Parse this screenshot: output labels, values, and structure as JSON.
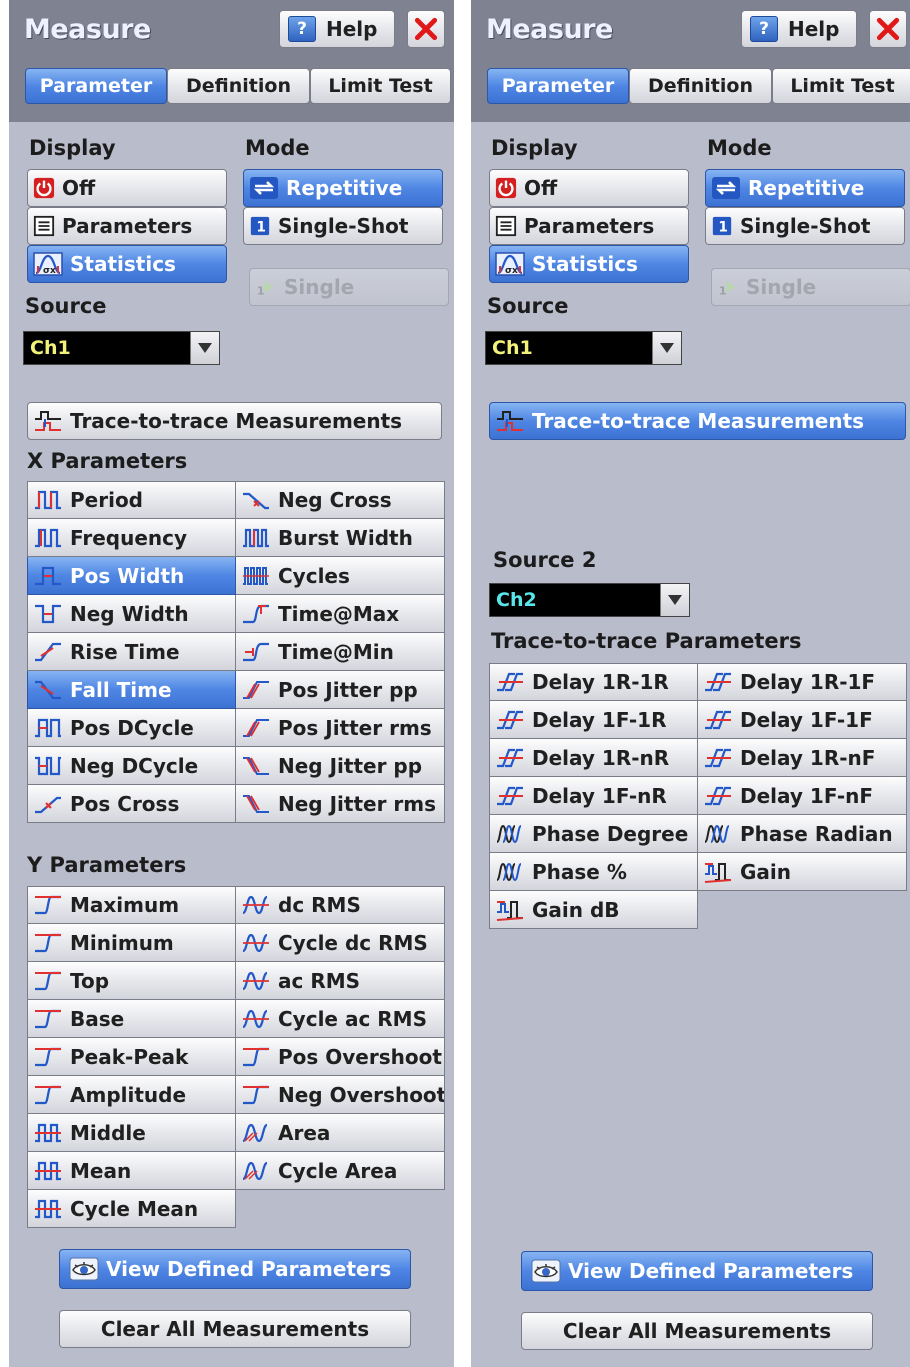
{
  "left": {
    "title": "Measure",
    "help_label": "Help",
    "tabs": [
      "Parameter",
      "Definition",
      "Limit Test"
    ],
    "display_heading": "Display",
    "display_options": [
      "Off",
      "Parameters",
      "Statistics"
    ],
    "mode_heading": "Mode",
    "mode_options": [
      "Repetitive",
      "Single-Shot"
    ],
    "single_label": "Single",
    "source_heading": "Source",
    "source_value": "Ch1",
    "trace_button": "Trace-to-trace Measurements",
    "x_heading": "X Parameters",
    "x_params": [
      "Period",
      "Neg Cross",
      "Frequency",
      "Burst Width",
      "Pos Width",
      "Cycles",
      "Neg Width",
      "Time@Max",
      "Rise Time",
      "Time@Min",
      "Fall Time",
      "Pos Jitter pp",
      "Pos DCycle",
      "Pos Jitter rms",
      "Neg DCycle",
      "Neg Jitter pp",
      "Pos Cross",
      "Neg Jitter rms"
    ],
    "y_heading": "Y Parameters",
    "y_params": [
      "Maximum",
      "dc RMS",
      "Minimum",
      "Cycle dc RMS",
      "Top",
      "ac RMS",
      "Base",
      "Cycle ac RMS",
      "Peak-Peak",
      "Pos Overshoot",
      "Amplitude",
      "Neg Overshoot",
      "Middle",
      "Area",
      "Mean",
      "Cycle Area",
      "Cycle Mean"
    ],
    "view_button": "View Defined Parameters",
    "clear_button": "Clear All Measurements"
  },
  "right": {
    "title": "Measure",
    "help_label": "Help",
    "tabs": [
      "Parameter",
      "Definition",
      "Limit Test"
    ],
    "display_heading": "Display",
    "display_options": [
      "Off",
      "Parameters",
      "Statistics"
    ],
    "mode_heading": "Mode",
    "mode_options": [
      "Repetitive",
      "Single-Shot"
    ],
    "single_label": "Single",
    "source_heading": "Source",
    "source_value": "Ch1",
    "trace_button": "Trace-to-trace Measurements",
    "source2_heading": "Source 2",
    "source2_value": "Ch2",
    "t2t_heading": "Trace-to-trace Parameters",
    "t2t_params": [
      "Delay 1R-1R",
      "Delay 1R-1F",
      "Delay 1F-1R",
      "Delay 1F-1F",
      "Delay 1R-nR",
      "Delay 1R-nF",
      "Delay 1F-nR",
      "Delay 1F-nF",
      "Phase Degree",
      "Phase Radian",
      "Phase %",
      "Gain",
      "Gain dB"
    ],
    "view_button": "View Defined Parameters",
    "clear_button": "Clear All Measurements"
  },
  "colors": {
    "accent_blue": "#4f86e4",
    "panel_bg": "#b9bccb",
    "header_bg": "#7e8291",
    "ch1_yellow": "#f2f27a",
    "ch2_cyan": "#58e6ea",
    "icon_red": "#e03030",
    "icon_blue": "#2358c8"
  }
}
